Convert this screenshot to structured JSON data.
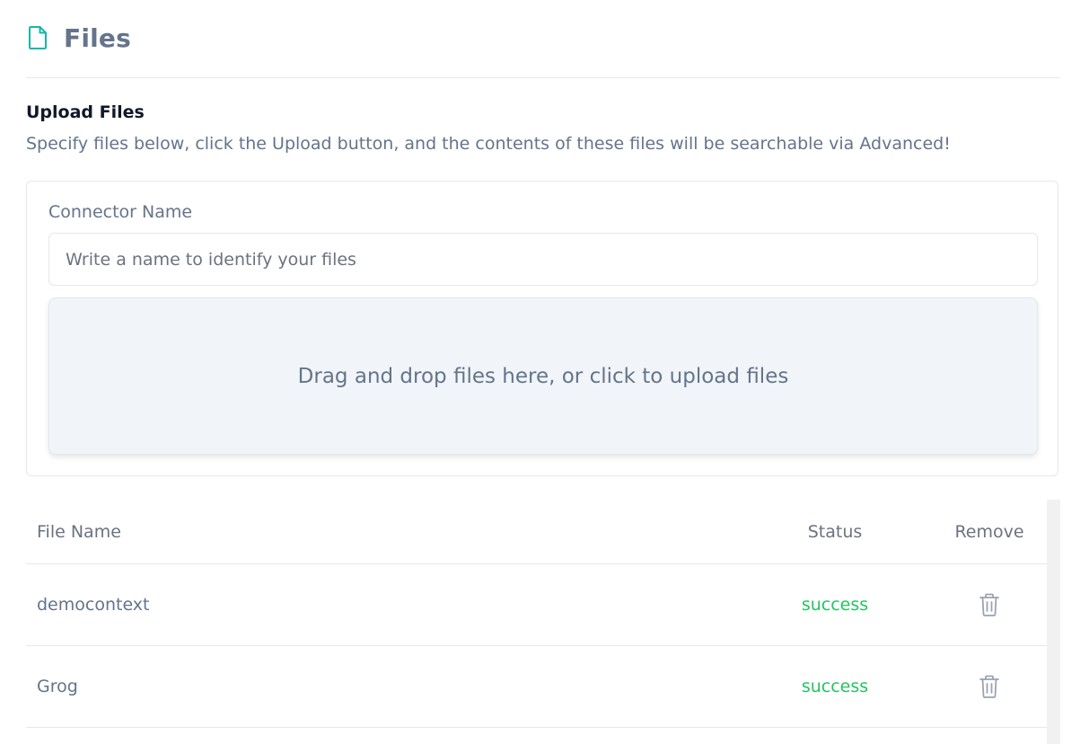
{
  "header": {
    "title": "Files",
    "icon": "file-icon",
    "icon_color": "#14b8a6"
  },
  "upload": {
    "title": "Upload Files",
    "description": "Specify files below, click the Upload button, and the contents of these files will be searchable via Advanced!",
    "connector_label": "Connector Name",
    "connector_placeholder": "Write a name to identify your files",
    "connector_value": "",
    "dropzone_text": "Drag and drop files here, or click to upload files"
  },
  "table": {
    "columns": {
      "file_name": "File Name",
      "status": "Status",
      "remove": "Remove"
    },
    "rows": [
      {
        "name": "democontext",
        "status": "success",
        "remove_icon": "trash-icon"
      },
      {
        "name": "Grog",
        "status": "success",
        "remove_icon": "trash-icon"
      }
    ]
  },
  "colors": {
    "success": "#22c55e",
    "accent": "#14b8a6",
    "text_muted": "#64748b"
  }
}
